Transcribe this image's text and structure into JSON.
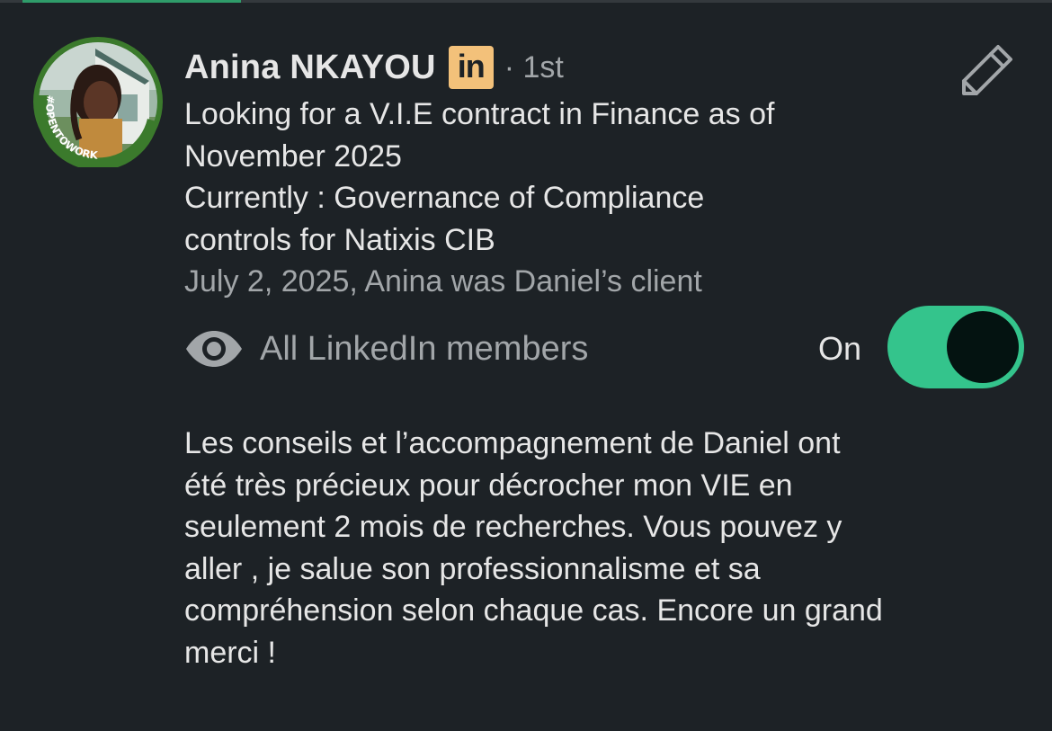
{
  "profile": {
    "name": "Anina NKAYOU",
    "badge_text": "in",
    "badge_icon": "linkedin-icon",
    "degree": "· 1st",
    "avatar_frame_text": "#OPENTOWORK",
    "headline_lines": [
      "Looking for a V.I.E contract in Finance as of",
      "November 2025",
      "Currently : Governance of Compliance",
      "controls for Natixis CIB"
    ],
    "meta": "July 2, 2025, Anina was Daniel’s client"
  },
  "visibility": {
    "icon": "eye-icon",
    "label": "All LinkedIn members",
    "toggle_label": "On",
    "toggle_on": true
  },
  "recommendation": {
    "lines": [
      "Les conseils et l’accompagnement de Daniel ont",
      "été très précieux pour décrocher mon VIE en",
      "seulement 2 mois de recherches. Vous pouvez y",
      "aller , je salue son professionnalisme et sa",
      "compréhension selon chaque cas. Encore un grand",
      "merci !"
    ]
  },
  "colors": {
    "background": "#1d2226",
    "toggle": "#34c48c",
    "open_to_work": "#3b7a2c",
    "badge": "#f3c17a"
  }
}
